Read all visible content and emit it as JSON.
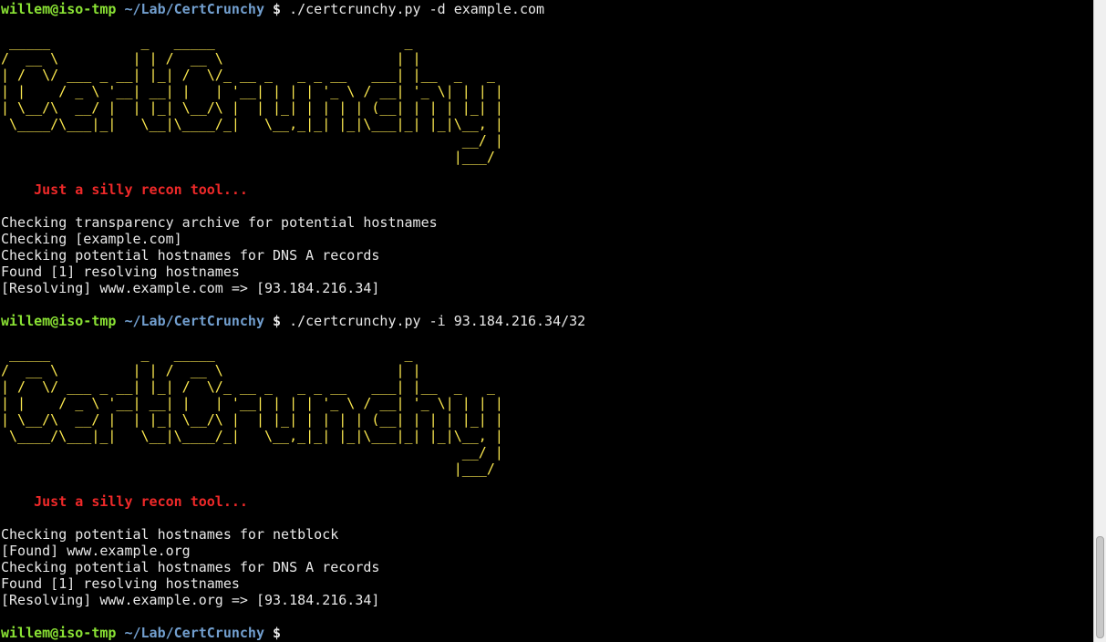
{
  "prompt": {
    "user_host": "willem@iso-tmp",
    "path": "~/Lab/CertCrunchy",
    "symbol": "$"
  },
  "session": [
    {
      "command": "./certcrunchy.py -d example.com",
      "banner": " _____           _   _____                       _\n/  __ \\         | | /  __ \\                     | |\n| /  \\/ ___ _ __| |_| /  \\/_ __ _   _ _ __   ___| |__  _   _\n| |    / _ \\ '__| __| |   | '__| | | | '_ \\ / __| '_ \\| | | |\n| \\__/\\  __/ |  | |_| \\__/\\ |  | |_| | | | | (__| | | | |_| |\n \\____/\\___|_|   \\__|\\____/_|   \\__,_|_| |_|\\___|_| |_|\\__, |\n                                                        __/ |\n                                                       |___/",
      "tagline": "Just a silly recon tool...",
      "output": [
        "Checking transparency archive for potential hostnames",
        "Checking [example.com]",
        "Checking potential hostnames for DNS A records",
        "Found [1] resolving hostnames",
        "[Resolving] www.example.com => [93.184.216.34]"
      ]
    },
    {
      "command": "./certcrunchy.py -i 93.184.216.34/32",
      "banner": " _____           _   _____                       _\n/  __ \\         | | /  __ \\                     | |\n| /  \\/ ___ _ __| |_| /  \\/_ __ _   _ _ __   ___| |__  _   _\n| |    / _ \\ '__| __| |   | '__| | | | '_ \\ / __| '_ \\| | | |\n| \\__/\\  __/ |  | |_| \\__/\\ |  | |_| | | | | (__| | | | |_| |\n \\____/\\___|_|   \\__|\\____/_|   \\__,_|_| |_|\\___|_| |_|\\__, |\n                                                        __/ |\n                                                       |___/",
      "tagline": "Just a silly recon tool...",
      "output": [
        "Checking potential hostnames for netblock",
        "[Found] www.example.org",
        "Checking potential hostnames for DNS A records",
        "Found [1] resolving hostnames",
        "[Resolving] www.example.org => [93.184.216.34]"
      ]
    }
  ],
  "final_prompt_command": "",
  "colors": {
    "background": "#000000",
    "foreground": "#e8e8e8",
    "user_host": "#8ae234",
    "path": "#729fcf",
    "banner": "#fce94f",
    "tagline": "#ef2929"
  }
}
